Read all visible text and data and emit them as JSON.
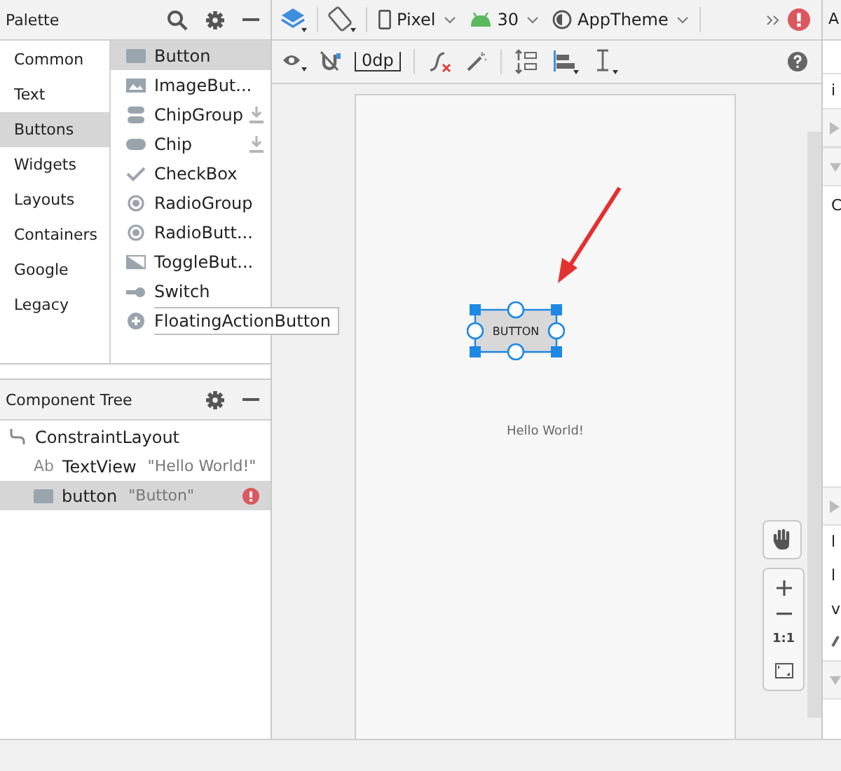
{
  "palette": {
    "title": "Palette",
    "categories": [
      {
        "label": "Common",
        "selected": false
      },
      {
        "label": "Text",
        "selected": false
      },
      {
        "label": "Buttons",
        "selected": true
      },
      {
        "label": "Widgets",
        "selected": false
      },
      {
        "label": "Layouts",
        "selected": false
      },
      {
        "label": "Containers",
        "selected": false
      },
      {
        "label": "Google",
        "selected": false
      },
      {
        "label": "Legacy",
        "selected": false
      }
    ],
    "items": [
      {
        "label": "Button",
        "kind": "button",
        "selected": true,
        "download": false,
        "tooltip": false
      },
      {
        "label": "ImageBut...",
        "kind": "image",
        "selected": false,
        "download": false,
        "tooltip": false
      },
      {
        "label": "ChipGroup",
        "kind": "chipgroup",
        "selected": false,
        "download": true,
        "tooltip": false
      },
      {
        "label": "Chip",
        "kind": "chip",
        "selected": false,
        "download": true,
        "tooltip": false
      },
      {
        "label": "CheckBox",
        "kind": "check",
        "selected": false,
        "download": false,
        "tooltip": false
      },
      {
        "label": "RadioGroup",
        "kind": "radio",
        "selected": false,
        "download": false,
        "tooltip": false
      },
      {
        "label": "RadioButt...",
        "kind": "radio",
        "selected": false,
        "download": false,
        "tooltip": false
      },
      {
        "label": "ToggleBut...",
        "kind": "toggle",
        "selected": false,
        "download": false,
        "tooltip": false
      },
      {
        "label": "Switch",
        "kind": "switch",
        "selected": false,
        "download": false,
        "tooltip": false
      },
      {
        "label": "FloatingActionButton",
        "kind": "fab",
        "selected": false,
        "download": false,
        "tooltip": true
      }
    ]
  },
  "toolbar": {
    "device": "Pixel",
    "api": "30",
    "theme": "AppTheme",
    "margin": "0dp"
  },
  "component_tree": {
    "title": "Component Tree",
    "nodes": [
      {
        "label": "ConstraintLayout",
        "kind": "layout",
        "selected": false,
        "error": false,
        "children": [
          {
            "label": "TextView",
            "kind": "text",
            "badge": "Ab",
            "value": "\"Hello World!\"",
            "selected": false,
            "error": false
          },
          {
            "label": "button",
            "kind": "button",
            "value": "\"Button\"",
            "selected": true,
            "error": true
          }
        ]
      }
    ]
  },
  "canvas": {
    "button_label": "BUTTON",
    "text_view": "Hello World!",
    "zoom_reset": "1:1"
  },
  "attributes": {
    "title": "A",
    "rows": [
      "i",
      "C",
      "l",
      "l",
      "v"
    ]
  }
}
